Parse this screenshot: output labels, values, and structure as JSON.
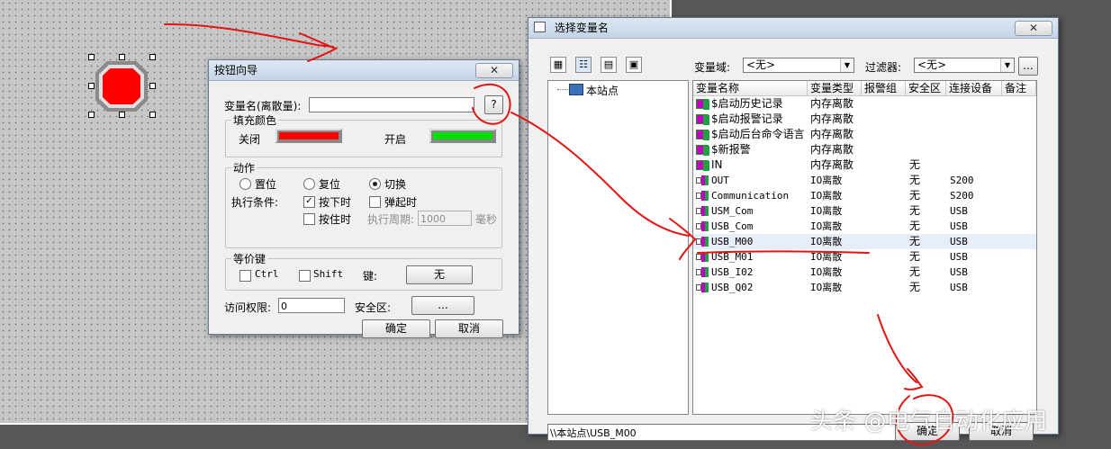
{
  "wizard": {
    "title": "按钮向导",
    "var_label": "变量名(离散量):",
    "var_value": "",
    "help_btn": "?",
    "fill_group": "填充颜色",
    "off_label": "关闭",
    "on_label": "开启",
    "off_color": "#ff0000",
    "on_color": "#00dd00",
    "action_group": "动作",
    "radio_set": "置位",
    "radio_reset": "复位",
    "radio_toggle": "切换",
    "exec_label": "执行条件:",
    "chk_press": "按下时",
    "chk_release": "弹起时",
    "chk_hold": "按住时",
    "period_label": "执行周期:",
    "period_value": "1000",
    "period_unit": "毫秒",
    "hotkey_group": "等价键",
    "ctrl": "Ctrl",
    "shift": "Shift",
    "key_label": "键:",
    "key_value": "无",
    "access_label": "访问权限:",
    "access_value": "0",
    "zone_label": "安全区:",
    "zone_btn": "...",
    "ok": "确定",
    "cancel": "取消"
  },
  "selector": {
    "title": "选择变量名",
    "domain_label": "变量域:",
    "domain_value": "<无>",
    "filter_label": "过滤器:",
    "filter_value": "<无>",
    "filter_btn": "...",
    "tree_root": "本站点",
    "columns": [
      "变量名称",
      "变量类型",
      "报警组",
      "安全区",
      "连接设备",
      "备注"
    ],
    "rows": [
      {
        "icon": "mem",
        "name": "$启动历史记录",
        "type": "内存离散",
        "group": "",
        "zone": "",
        "device": ""
      },
      {
        "icon": "mem",
        "name": "$启动报警记录",
        "type": "内存离散",
        "group": "",
        "zone": "",
        "device": ""
      },
      {
        "icon": "mem",
        "name": "$启动后台命令语言",
        "type": "内存离散",
        "group": "",
        "zone": "",
        "device": ""
      },
      {
        "icon": "mem",
        "name": "$新报警",
        "type": "内存离散",
        "group": "",
        "zone": "",
        "device": ""
      },
      {
        "icon": "mem",
        "name": "IN",
        "type": "内存离散",
        "group": "",
        "zone": "无",
        "device": ""
      },
      {
        "icon": "io",
        "name": "OUT",
        "type": "IO离散",
        "group": "",
        "zone": "无",
        "device": "S200"
      },
      {
        "icon": "io",
        "name": "Communication",
        "type": "IO离散",
        "group": "",
        "zone": "无",
        "device": "S200"
      },
      {
        "icon": "io",
        "name": "USM_Com",
        "type": "IO离散",
        "group": "",
        "zone": "无",
        "device": "USB"
      },
      {
        "icon": "io",
        "name": "USB_Com",
        "type": "IO离散",
        "group": "",
        "zone": "无",
        "device": "USB"
      },
      {
        "icon": "io",
        "name": "USB_M00",
        "type": "IO离散",
        "group": "",
        "zone": "无",
        "device": "USB"
      },
      {
        "icon": "io",
        "name": "USB_M01",
        "type": "IO离散",
        "group": "",
        "zone": "无",
        "device": "USB"
      },
      {
        "icon": "io",
        "name": "USB_I02",
        "type": "IO离散",
        "group": "",
        "zone": "无",
        "device": "USB"
      },
      {
        "icon": "io",
        "name": "USB_Q02",
        "type": "IO离散",
        "group": "",
        "zone": "无",
        "device": "USB"
      }
    ],
    "path_value": "\\\\本站点\\USB_M00",
    "ok": "确定",
    "cancel": "取消"
  },
  "watermark": "头条 @电气自动化应用"
}
